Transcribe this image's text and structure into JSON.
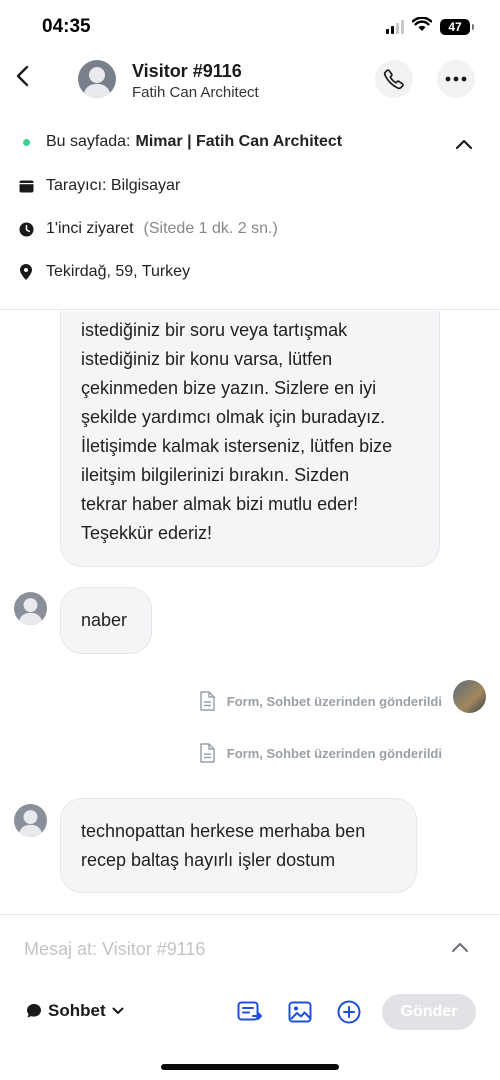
{
  "status_bar": {
    "time": "04:35",
    "battery": "47"
  },
  "header": {
    "title": "Visitor #9116",
    "subtitle": "Fatih Can Architect"
  },
  "info": {
    "page_label": "Bu sayfada:",
    "page_value": "Mimar | Fatih Can Architect",
    "browser": "Tarayıcı: Bilgisayar",
    "visit": "1'inci ziyaret",
    "visit_duration": "(Sitede 1 dk. 2 sn.)",
    "location": "Tekirdağ, 59, Turkey"
  },
  "messages": {
    "bot_text": "istediğiniz bir soru veya tartışmak\nistediğiniz bir konu varsa, lütfen\nçekinmeden bize yazın. Sizlere en iyi\nşekilde yardımcı olmak için buradayız.\nİletişimde kalmak isterseniz, lütfen bize\nileitşim bilgilerinizi bırakın. Sizden\ntekrar haber almak bizi mutlu eder!\nTeşekkür ederiz!",
    "visitor_1": "naber",
    "system_1": "Form, Sohbet üzerinden gönderildi",
    "system_2": "Form, Sohbet üzerinden gönderildi",
    "visitor_2": "technopattan herkese merhaba ben\nrecep baltaş hayırlı işler dostum"
  },
  "composer": {
    "placeholder": "Mesaj at: Visitor #9116",
    "channel": "Sohbet",
    "send_label": "Gönder"
  }
}
